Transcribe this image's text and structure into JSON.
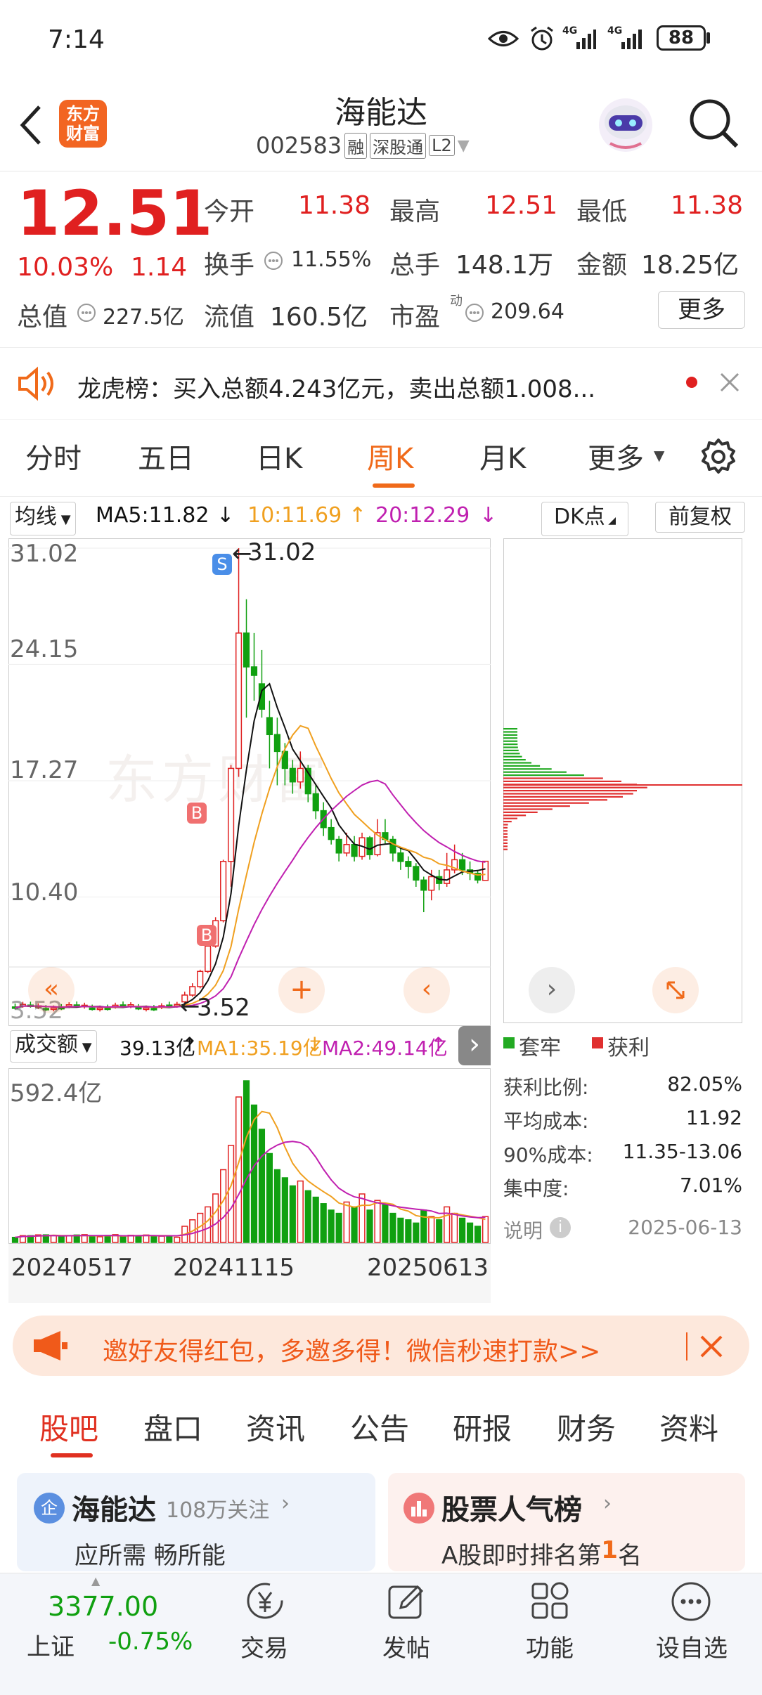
{
  "status_bar": {
    "time": "7:14",
    "battery": "88",
    "net1": "4G",
    "net2": "4G"
  },
  "header": {
    "app_logo_line1": "东方",
    "app_logo_line2": "财富",
    "stock_name": "海能达",
    "stock_code": "002583",
    "tag_margin": "融",
    "tag_connect": "深股通",
    "tag_level": "L2"
  },
  "quote": {
    "price": "12.51",
    "change_pct": "10.03%",
    "change": "1.14",
    "open_label": "今开",
    "open": "11.38",
    "high_label": "最高",
    "high": "12.51",
    "low_label": "最低",
    "low": "11.38",
    "turnover_label": "换手",
    "turnover": "11.55%",
    "volume_label": "总手",
    "volume": "148.1万",
    "amount_label": "金额",
    "amount": "18.25亿",
    "mcap_label": "总值",
    "mcap": "227.5亿",
    "float_label": "流值",
    "float": "160.5亿",
    "pe_label": "市盈",
    "pe_sup": "动",
    "pe": "209.64",
    "more_label": "更多"
  },
  "notice": {
    "text": "龙虎榜：买入总额4.243亿元，卖出总额1.008..."
  },
  "chart_tabs": [
    {
      "label": "分时"
    },
    {
      "label": "五日"
    },
    {
      "label": "日K"
    },
    {
      "label": "周K"
    },
    {
      "label": "月K"
    },
    {
      "label": "更多"
    }
  ],
  "ma_bar": {
    "selector": "均线",
    "ma5": "MA5:11.82",
    "ma10": "10:11.69",
    "ma20": "20:12.29",
    "dk_label": "DK点",
    "fq_label": "前复权"
  },
  "kline": {
    "y_labels": [
      "31.02",
      "24.15",
      "17.27",
      "10.40",
      "3.52"
    ],
    "max_label": "31.02",
    "min_label": "3.52",
    "mark_s": "S",
    "mark_b": "B",
    "watermark": "东方财富"
  },
  "vol_bar": {
    "selector": "成交额",
    "v": "39.13亿",
    "ma1": "MA1:35.19亿",
    "ma2": "MA2:49.14亿",
    "y_label": "592.4亿"
  },
  "x_labels": [
    "20240517",
    "20241115",
    "20250613"
  ],
  "chip": {
    "legend_trapped": "套牢",
    "legend_profit": "获利",
    "rows": [
      {
        "label": "获利比例:",
        "value": "82.05%"
      },
      {
        "label": "平均成本:",
        "value": "11.92"
      },
      {
        "label": "90%成本:",
        "value": "11.35-13.06"
      },
      {
        "label": "集中度:",
        "value": "7.01%"
      }
    ],
    "explain": "说明",
    "date": "2025-06-13"
  },
  "promo": {
    "text": "邀好友得红包，多邀多得！微信秒速打款>>"
  },
  "bottom_tabs": [
    {
      "label": "股吧"
    },
    {
      "label": "盘口"
    },
    {
      "label": "资讯"
    },
    {
      "label": "公告"
    },
    {
      "label": "研报"
    },
    {
      "label": "财务"
    },
    {
      "label": "资料"
    }
  ],
  "cards": {
    "left_badge": "企",
    "left_title": "海能达",
    "left_follow": "108万关注",
    "left_sub": "应所需 畅所能",
    "right_title": "股票人气榜",
    "right_sub_prefix": "A股即时排名第",
    "right_rank": "1",
    "right_sub_suffix": "名"
  },
  "nav": {
    "index_value": "3377.00",
    "index_name": "上证",
    "index_change": "-0.75%",
    "items": [
      {
        "label": "交易"
      },
      {
        "label": "发帖"
      },
      {
        "label": "功能"
      },
      {
        "label": "设自选"
      }
    ]
  },
  "colors": {
    "up": "#e02020",
    "down": "#10a010",
    "accent": "#f06a1a",
    "ma5": "#111111",
    "ma10": "#f0a020",
    "ma20": "#c020b0"
  }
}
